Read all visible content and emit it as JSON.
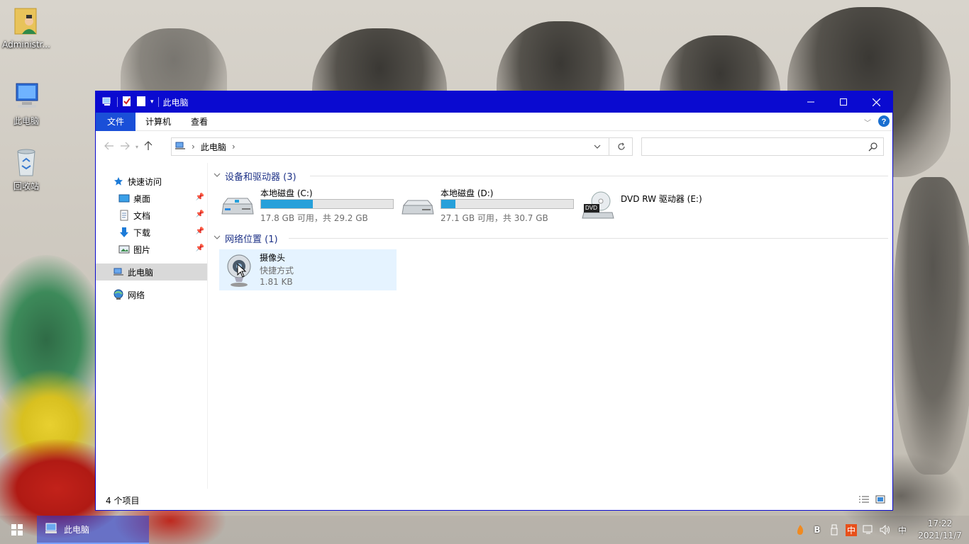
{
  "desktop": {
    "icons": [
      {
        "label": "Administr..."
      },
      {
        "label": "此电脑"
      },
      {
        "label": "回收站"
      }
    ]
  },
  "window": {
    "title": "此电脑",
    "ribbon_tabs": [
      "文件",
      "计算机",
      "查看"
    ],
    "address": {
      "location": "此电脑"
    },
    "search": {
      "placeholder": ""
    },
    "sidebar": {
      "quick_access": "快速访问",
      "quick_items": [
        "桌面",
        "文档",
        "下载",
        "图片"
      ],
      "this_pc": "此电脑",
      "network": "网络"
    },
    "groups": {
      "devices": {
        "header": "设备和驱动器 (3)",
        "drives": [
          {
            "name": "本地磁盘 (C:)",
            "info": "17.8 GB 可用，共 29.2 GB",
            "used_fraction": 0.39
          },
          {
            "name": "本地磁盘 (D:)",
            "info": "27.1 GB 可用，共 30.7 GB",
            "used_fraction": 0.11
          },
          {
            "name": "DVD RW 驱动器 (E:)",
            "badge": "DVD"
          }
        ]
      },
      "network": {
        "header": "网络位置 (1)",
        "items": [
          {
            "name": "摄像头",
            "type": "快捷方式",
            "size": "1.81 KB"
          }
        ]
      }
    },
    "status": {
      "count": "4 个项目"
    }
  },
  "taskbar": {
    "app_label": "此电脑",
    "ime_badge": "中",
    "ime_text": "中",
    "time": "17:22",
    "date": "2021/11/7"
  },
  "colors": {
    "titlebar": "#0a0ad0",
    "ribbon_active": "#1a4fd8",
    "drive_fill": "#26a0da",
    "group_header": "#1e3287",
    "selection": "#e5f3ff"
  }
}
